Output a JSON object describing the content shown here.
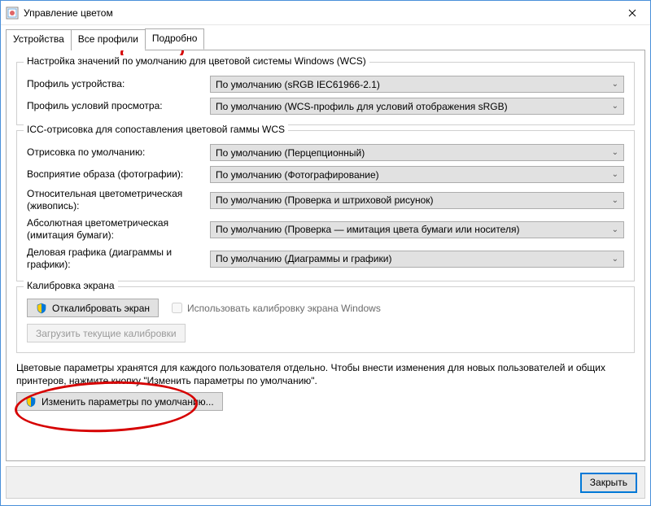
{
  "window": {
    "title": "Управление цветом"
  },
  "tabs": {
    "devices": "Устройства",
    "allprofiles": "Все профили",
    "advanced": "Подробно"
  },
  "wcs": {
    "group_title": "Настройка значений по умолчанию для цветовой системы Windows (WCS)",
    "device_label": "Профиль устройства:",
    "device_value": "По умолчанию (sRGB IEC61966-2.1)",
    "viewing_label": "Профиль условий просмотра:",
    "viewing_value": "По умолчанию (WCS-профиль для условий отображения sRGB)"
  },
  "icc": {
    "group_title": "ICC-отрисовка для сопоставления цветовой гаммы WCS",
    "default_render_label": "Отрисовка по умолчанию:",
    "default_render_value": "По умолчанию (Перцепционный)",
    "perceptual_label": "Восприятие образа (фотографии):",
    "perceptual_value": "По умолчанию (Фотографирование)",
    "relative_label": "Относительная цветометрическая (живопись):",
    "relative_value": "По умолчанию (Проверка и штриховой рисунок)",
    "absolute_label": "Абсолютная цветометрическая (имитация бумаги):",
    "absolute_value": "По умолчанию (Проверка — имитация цвета бумаги или носителя)",
    "business_label": "Деловая графика (диаграммы и графики):",
    "business_value": "По умолчанию (Диаграммы и графики)"
  },
  "calib": {
    "group_title": "Калибровка экрана",
    "calibrate_btn": "Откалибровать экран",
    "use_windows_calib": "Использовать калибровку экрана Windows",
    "reload_btn": "Загрузить текущие калибровки"
  },
  "note": "Цветовые параметры хранятся для каждого пользователя отдельно. Чтобы внести изменения для новых пользователей и общих принтеров, нажмите кнопку \"Изменить параметры по умолчанию\".",
  "change_defaults_btn": "Изменить параметры по умолчанию...",
  "close_btn": "Закрыть"
}
